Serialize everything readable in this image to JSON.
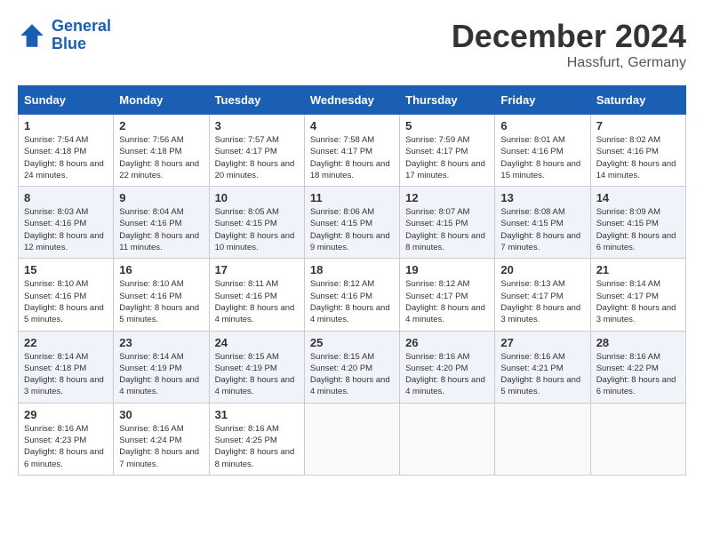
{
  "header": {
    "logo_line1": "General",
    "logo_line2": "Blue",
    "month": "December 2024",
    "location": "Hassfurt, Germany"
  },
  "days_of_week": [
    "Sunday",
    "Monday",
    "Tuesday",
    "Wednesday",
    "Thursday",
    "Friday",
    "Saturday"
  ],
  "weeks": [
    [
      {
        "day": "1",
        "sunrise": "7:54 AM",
        "sunset": "4:18 PM",
        "daylight": "8 hours and 24 minutes."
      },
      {
        "day": "2",
        "sunrise": "7:56 AM",
        "sunset": "4:18 PM",
        "daylight": "8 hours and 22 minutes."
      },
      {
        "day": "3",
        "sunrise": "7:57 AM",
        "sunset": "4:17 PM",
        "daylight": "8 hours and 20 minutes."
      },
      {
        "day": "4",
        "sunrise": "7:58 AM",
        "sunset": "4:17 PM",
        "daylight": "8 hours and 18 minutes."
      },
      {
        "day": "5",
        "sunrise": "7:59 AM",
        "sunset": "4:17 PM",
        "daylight": "8 hours and 17 minutes."
      },
      {
        "day": "6",
        "sunrise": "8:01 AM",
        "sunset": "4:16 PM",
        "daylight": "8 hours and 15 minutes."
      },
      {
        "day": "7",
        "sunrise": "8:02 AM",
        "sunset": "4:16 PM",
        "daylight": "8 hours and 14 minutes."
      }
    ],
    [
      {
        "day": "8",
        "sunrise": "8:03 AM",
        "sunset": "4:16 PM",
        "daylight": "8 hours and 12 minutes."
      },
      {
        "day": "9",
        "sunrise": "8:04 AM",
        "sunset": "4:16 PM",
        "daylight": "8 hours and 11 minutes."
      },
      {
        "day": "10",
        "sunrise": "8:05 AM",
        "sunset": "4:15 PM",
        "daylight": "8 hours and 10 minutes."
      },
      {
        "day": "11",
        "sunrise": "8:06 AM",
        "sunset": "4:15 PM",
        "daylight": "8 hours and 9 minutes."
      },
      {
        "day": "12",
        "sunrise": "8:07 AM",
        "sunset": "4:15 PM",
        "daylight": "8 hours and 8 minutes."
      },
      {
        "day": "13",
        "sunrise": "8:08 AM",
        "sunset": "4:15 PM",
        "daylight": "8 hours and 7 minutes."
      },
      {
        "day": "14",
        "sunrise": "8:09 AM",
        "sunset": "4:15 PM",
        "daylight": "8 hours and 6 minutes."
      }
    ],
    [
      {
        "day": "15",
        "sunrise": "8:10 AM",
        "sunset": "4:16 PM",
        "daylight": "8 hours and 5 minutes."
      },
      {
        "day": "16",
        "sunrise": "8:10 AM",
        "sunset": "4:16 PM",
        "daylight": "8 hours and 5 minutes."
      },
      {
        "day": "17",
        "sunrise": "8:11 AM",
        "sunset": "4:16 PM",
        "daylight": "8 hours and 4 minutes."
      },
      {
        "day": "18",
        "sunrise": "8:12 AM",
        "sunset": "4:16 PM",
        "daylight": "8 hours and 4 minutes."
      },
      {
        "day": "19",
        "sunrise": "8:12 AM",
        "sunset": "4:17 PM",
        "daylight": "8 hours and 4 minutes."
      },
      {
        "day": "20",
        "sunrise": "8:13 AM",
        "sunset": "4:17 PM",
        "daylight": "8 hours and 3 minutes."
      },
      {
        "day": "21",
        "sunrise": "8:14 AM",
        "sunset": "4:17 PM",
        "daylight": "8 hours and 3 minutes."
      }
    ],
    [
      {
        "day": "22",
        "sunrise": "8:14 AM",
        "sunset": "4:18 PM",
        "daylight": "8 hours and 3 minutes."
      },
      {
        "day": "23",
        "sunrise": "8:14 AM",
        "sunset": "4:19 PM",
        "daylight": "8 hours and 4 minutes."
      },
      {
        "day": "24",
        "sunrise": "8:15 AM",
        "sunset": "4:19 PM",
        "daylight": "8 hours and 4 minutes."
      },
      {
        "day": "25",
        "sunrise": "8:15 AM",
        "sunset": "4:20 PM",
        "daylight": "8 hours and 4 minutes."
      },
      {
        "day": "26",
        "sunrise": "8:16 AM",
        "sunset": "4:20 PM",
        "daylight": "8 hours and 4 minutes."
      },
      {
        "day": "27",
        "sunrise": "8:16 AM",
        "sunset": "4:21 PM",
        "daylight": "8 hours and 5 minutes."
      },
      {
        "day": "28",
        "sunrise": "8:16 AM",
        "sunset": "4:22 PM",
        "daylight": "8 hours and 6 minutes."
      }
    ],
    [
      {
        "day": "29",
        "sunrise": "8:16 AM",
        "sunset": "4:23 PM",
        "daylight": "8 hours and 6 minutes."
      },
      {
        "day": "30",
        "sunrise": "8:16 AM",
        "sunset": "4:24 PM",
        "daylight": "8 hours and 7 minutes."
      },
      {
        "day": "31",
        "sunrise": "8:16 AM",
        "sunset": "4:25 PM",
        "daylight": "8 hours and 8 minutes."
      },
      null,
      null,
      null,
      null
    ]
  ]
}
